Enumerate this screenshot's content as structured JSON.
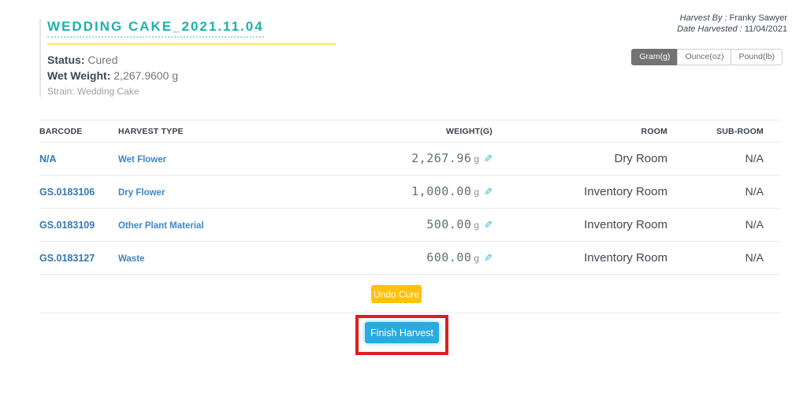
{
  "header": {
    "title": "WEDDING CAKE_2021.11.04",
    "status_label": "Status:",
    "status_value": "Cured",
    "wet_weight_label": "Wet Weight:",
    "wet_weight_value": "2,267.9600 g",
    "strain": "Strain: Wedding Cake",
    "harvest_by_label": "Harvest By :",
    "harvest_by_value": "Franky Sawyer",
    "date_harvested_label": "Date Harvested :",
    "date_harvested_value": "11/04/2021"
  },
  "unit_toggle": {
    "options": [
      {
        "label": "Gram(g)",
        "selected": true
      },
      {
        "label": "Ounce(oz)",
        "selected": false
      },
      {
        "label": "Pound(lb)",
        "selected": false
      }
    ]
  },
  "table": {
    "columns": [
      "BARCODE",
      "HARVEST TYPE",
      "WEIGHT(G)",
      "ROOM",
      "SUB-ROOM"
    ],
    "edit_icon": "✎",
    "rows": [
      {
        "barcode": "N/A",
        "harvest_type": "Wet Flower",
        "weight": "2,267.96",
        "unit": "g",
        "room": "Dry Room",
        "sub_room": "N/A"
      },
      {
        "barcode": "GS.0183106",
        "harvest_type": "Dry Flower",
        "weight": "1,000.00",
        "unit": "g",
        "room": "Inventory Room",
        "sub_room": "N/A"
      },
      {
        "barcode": "GS.0183109",
        "harvest_type": "Other Plant Material",
        "weight": "500.00",
        "unit": "g",
        "room": "Inventory Room",
        "sub_room": "N/A"
      },
      {
        "barcode": "GS.0183127",
        "harvest_type": "Waste",
        "weight": "600.00",
        "unit": "g",
        "room": "Inventory Room",
        "sub_room": "N/A"
      }
    ]
  },
  "buttons": {
    "undo_cure": "Undo Cure",
    "finish_harvest": "Finish Harvest"
  },
  "colors": {
    "accent_teal": "#1ab3aa",
    "yellow_rule": "#ffe45e",
    "link_blue": "#3279b9",
    "undo_amber": "#ffc10d",
    "finish_blue": "#29aae1",
    "annotation_red": "#dc1f1f"
  }
}
